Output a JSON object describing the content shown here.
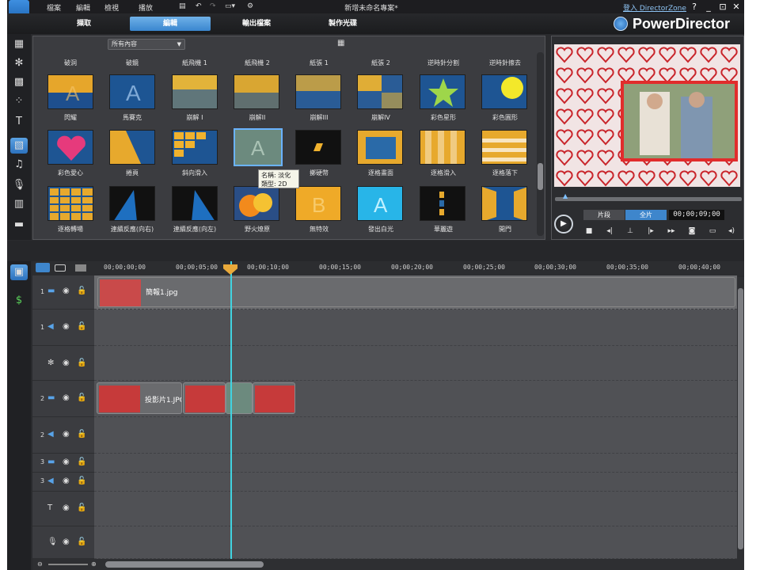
{
  "menu": {
    "items": [
      "檔案",
      "編輯",
      "檢視",
      "播放"
    ]
  },
  "window": {
    "title": "新增未命名專案*",
    "login": "登入 DirectorZone",
    "help": "?",
    "min": "_",
    "restore": "⊡",
    "close": "✕"
  },
  "modes": {
    "items": [
      "擷取",
      "編輯",
      "輸出檔案",
      "製作光碟"
    ],
    "active": "編輯"
  },
  "brand": {
    "name": "PowerDirector",
    "accent": "#3a86cf"
  },
  "library": {
    "filter": "所有內容",
    "top_labels": [
      "破洞",
      "破鏡",
      "紙飛機 1",
      "紙飛機 2",
      "紙張 1",
      "紙張 2",
      "逆時針分割",
      "逆時針擦去"
    ],
    "rows": [
      [
        "閃耀",
        "馬賽克",
        "崩解 I",
        "崩解II",
        "崩解III",
        "崩解IV",
        "彩色星形",
        "彩色圓形"
      ],
      [
        "彩色愛心",
        "捲頁",
        "斜向滑入",
        "淡化",
        "擲硬幣",
        "逐格畫面",
        "逐格滑入",
        "逐格落下"
      ],
      [
        "逐格轉場",
        "連續反應(向右)",
        "連續反應(向左)",
        "野火燎原",
        "無特效",
        "發出白光",
        "華麗遊",
        "開門"
      ]
    ],
    "tooltip": {
      "name": "名稱: 淡化",
      "type": "類型: 2D"
    }
  },
  "preview": {
    "segments": [
      "片段",
      "全片"
    ],
    "active_segment": "全片",
    "timecode": "00;00;09;00",
    "controls": [
      "stop",
      "prev-frame",
      "snapshot-marker",
      "next-frame",
      "fast-forward",
      "snapshot",
      "display",
      "volume"
    ]
  },
  "timeline": {
    "ruler": [
      "00;00;00;00",
      "00;00;05;00",
      "00;00;10;00",
      "00;00;15;00",
      "00;00;20;00",
      "00;00;25;00",
      "00;00;30;00",
      "00;00;35;00",
      "00;00;40;00"
    ],
    "tracks": [
      {
        "num": "1",
        "kind": "video"
      },
      {
        "num": "1",
        "kind": "audio"
      },
      {
        "num": "",
        "kind": "effect"
      },
      {
        "num": "2",
        "kind": "video"
      },
      {
        "num": "2",
        "kind": "audio"
      },
      {
        "num": "3",
        "kind": "video"
      },
      {
        "num": "3",
        "kind": "audio"
      },
      {
        "num": "",
        "kind": "title"
      },
      {
        "num": "",
        "kind": "voice"
      }
    ],
    "clips": {
      "background": "簡報1.jpg",
      "slide": "投影片1.JPG"
    }
  }
}
